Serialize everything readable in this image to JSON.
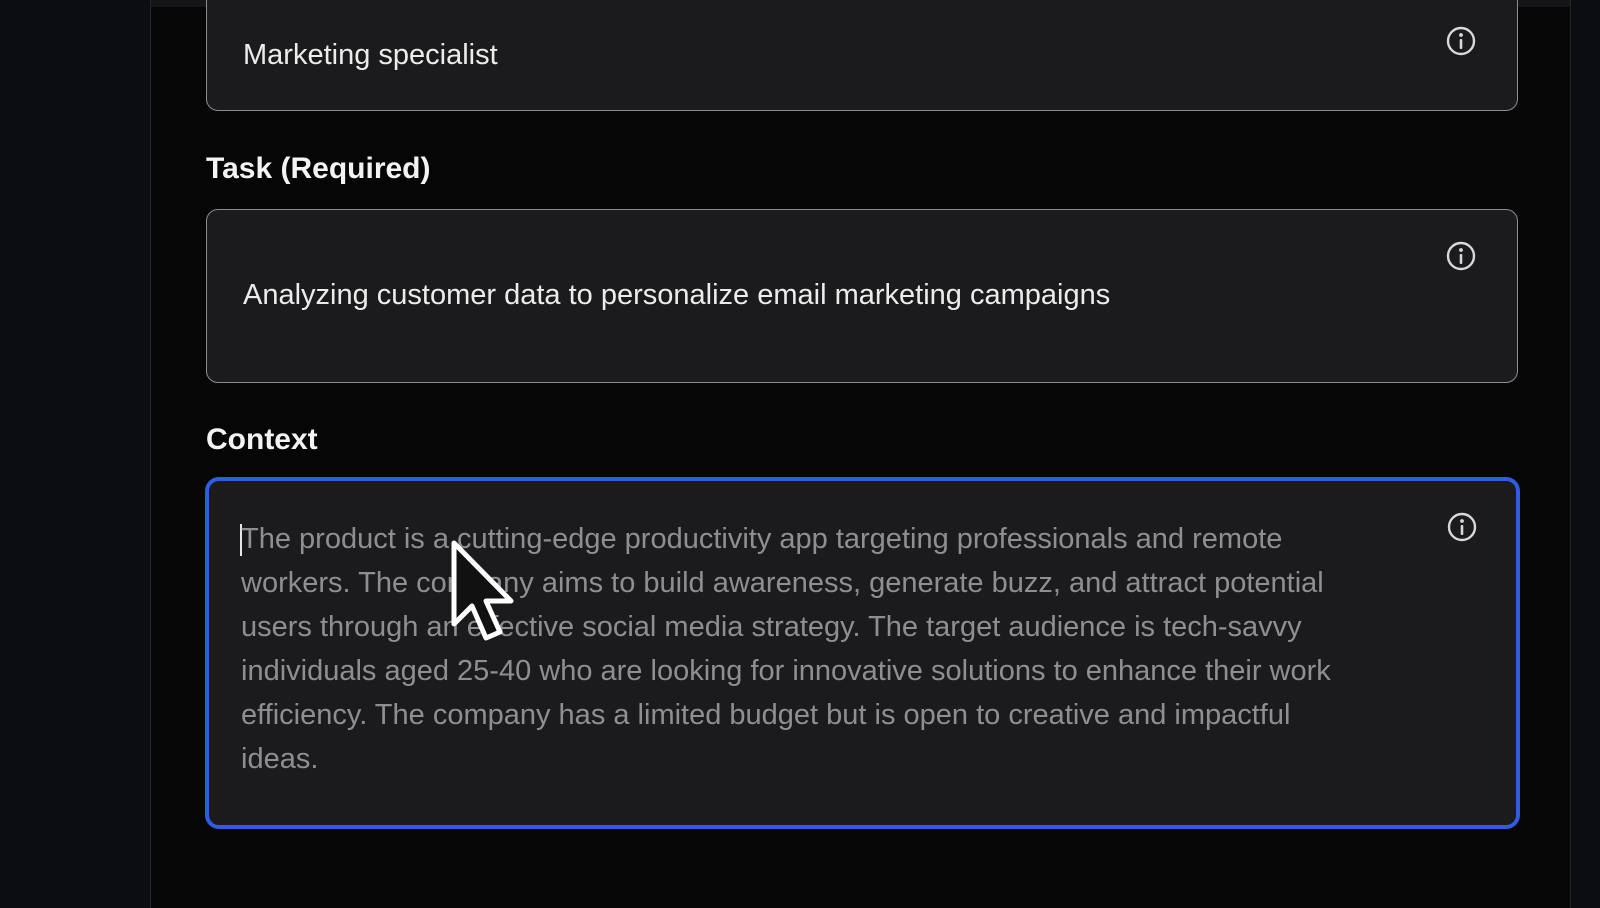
{
  "role_field": {
    "value": "Marketing specialist",
    "info_icon": "info-circle-icon"
  },
  "task_field": {
    "label": "Task (Required)",
    "value": "Analyzing customer data to personalize email marketing campaigns",
    "info_icon": "info-circle-icon"
  },
  "context_field": {
    "label": "Context",
    "placeholder": "The product is a cutting-edge productivity app targeting professionals and remote workers. The company aims to build awareness, generate buzz, and attract potential users through an effective social media strategy. The target audience is tech-savvy individuals aged 25-40 who are looking for innovative solutions to enhance their work efficiency. The company has a limited budget but is open to creative and impactful ideas.",
    "info_icon": "info-circle-icon",
    "focused": true
  },
  "colors": {
    "background": "#060607",
    "field_background": "#1b1b1d",
    "field_border": "#8d8d90",
    "focus_border": "#2f5ce0",
    "text": "#ececec",
    "placeholder_text": "#8f8f92"
  },
  "cursor_icon": "mouse-pointer-icon"
}
